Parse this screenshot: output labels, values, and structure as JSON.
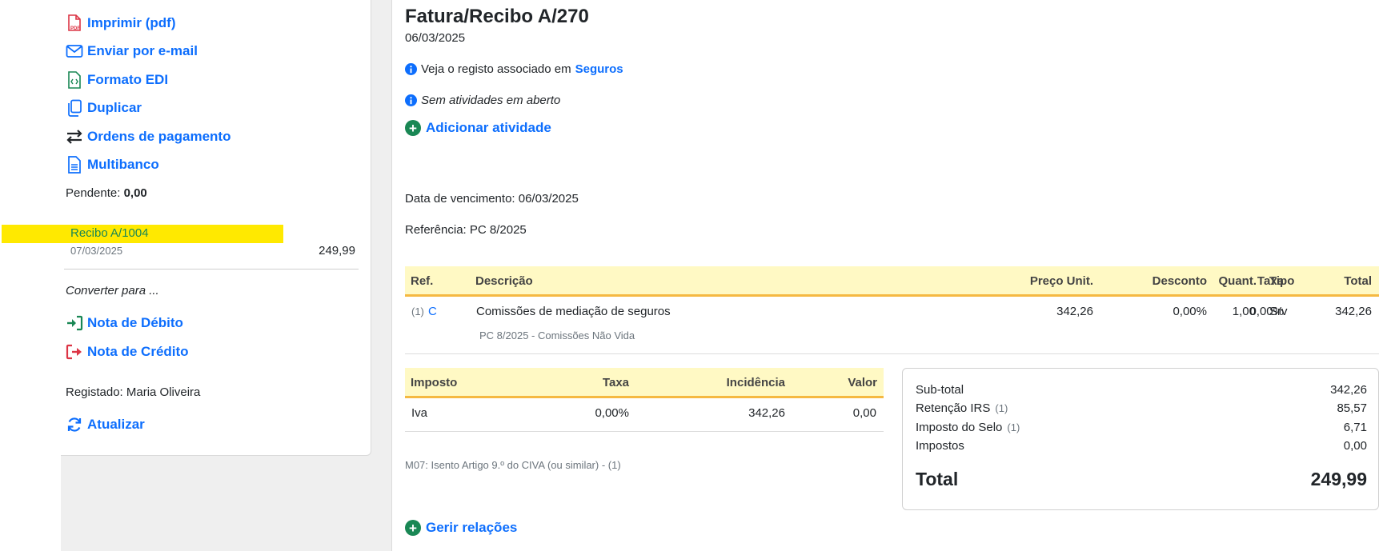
{
  "sidebar": {
    "actions": [
      {
        "label": "Imprimir (pdf)",
        "icon": "pdf-icon"
      },
      {
        "label": "Enviar por e-mail",
        "icon": "envelope-icon"
      },
      {
        "label": "Formato EDI",
        "icon": "code-file-icon"
      },
      {
        "label": "Duplicar",
        "icon": "copy-icon"
      },
      {
        "label": "Ordens de pagamento",
        "icon": "arrows-exchange-icon"
      },
      {
        "label": "Multibanco",
        "icon": "document-icon"
      }
    ],
    "pending_label": "Pendente:",
    "pending_value": "0,00",
    "receipt": {
      "label": "Recibo A/1004",
      "date": "07/03/2025",
      "amount": "249,99"
    },
    "convert_label": "Converter para ...",
    "convert_actions": [
      {
        "label": "Nota de Débito",
        "icon": "sign-in-icon"
      },
      {
        "label": "Nota de Crédito",
        "icon": "sign-out-icon"
      }
    ],
    "registered": "Registado: Maria Oliveira",
    "refresh_label": "Atualizar"
  },
  "document": {
    "title": "Fatura/Recibo A/270",
    "date": "06/03/2025",
    "associated_prefix": "Veja o registo associado em",
    "associated_link": "Seguros",
    "no_activities": "Sem atividades em aberto",
    "add_activity": "Adicionar atividade",
    "due_date": "Data de vencimento: 06/03/2025",
    "reference": "Referência: PC 8/2025"
  },
  "items_table": {
    "headers": {
      "ref": "Ref.",
      "desc": "Descrição",
      "qty": "Quant.",
      "type": "Tipo",
      "price": "Preço Unit.",
      "discount": "Desconto",
      "rate": "Taxa",
      "total": "Total"
    },
    "rows": [
      {
        "ref_num": "(1)",
        "ref_code": "C",
        "desc": "Comissões de mediação de seguros",
        "sub": "PC 8/2025 - Comissões Não Vida",
        "qty": "1,00",
        "type": "Srv",
        "price": "342,26",
        "discount": "0,00%",
        "rate": "0,00%",
        "total": "342,26"
      }
    ]
  },
  "tax_table": {
    "headers": {
      "tax": "Imposto",
      "rate": "Taxa",
      "base": "Incidência",
      "value": "Valor"
    },
    "rows": [
      {
        "tax": "Iva",
        "rate": "0,00%",
        "base": "342,26",
        "value": "0,00"
      }
    ],
    "exemption": "M07: Isento Artigo 9.º do CIVA (ou similar) - (1)"
  },
  "totals": {
    "subtotal_label": "Sub-total",
    "subtotal": "342,26",
    "irs_label": "Retenção IRS",
    "irs_note": "(1)",
    "irs": "85,57",
    "stamp_label": "Imposto do Selo",
    "stamp_note": "(1)",
    "stamp": "6,71",
    "taxes_label": "Impostos",
    "taxes": "0,00",
    "total_label": "Total",
    "total": "249,99"
  },
  "relations_label": "Gerir relações",
  "colors": {
    "link": "#0d6efd",
    "green": "#198754",
    "red": "#dc3545",
    "highlight": "#ffe900",
    "table_head": "#fff9c4",
    "table_border": "#f5b942"
  }
}
